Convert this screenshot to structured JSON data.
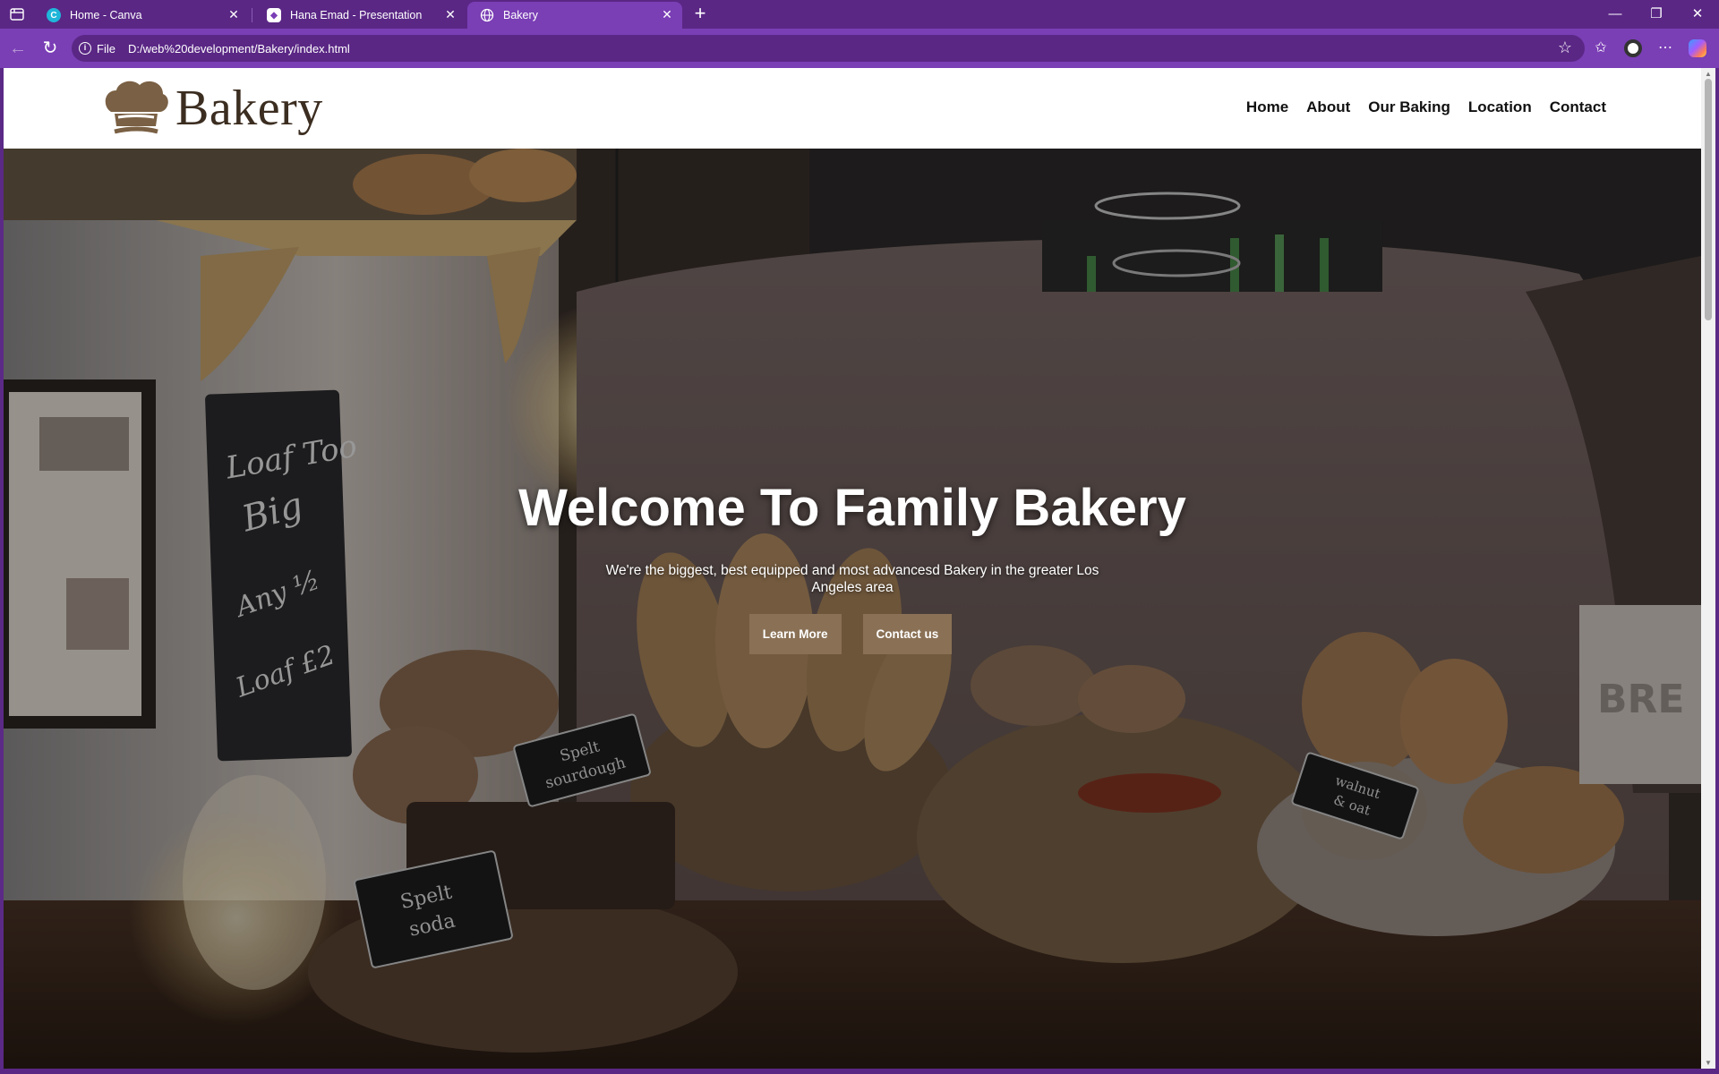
{
  "browser": {
    "tabs": [
      {
        "title": "Home - Canva",
        "active": false,
        "favicon": "canva-icon"
      },
      {
        "title": "Hana Emad - Presentation",
        "active": false,
        "favicon": "canva-presentation-icon"
      },
      {
        "title": "Bakery",
        "active": true,
        "favicon": "globe-icon"
      }
    ],
    "address": {
      "scheme_label": "File",
      "url": "D:/web%20development/Bakery/index.html"
    },
    "colors": {
      "chrome": "#5a2785",
      "active": "#7a3eb5"
    }
  },
  "site": {
    "logo_text": "Bakery",
    "nav": [
      "Home",
      "About",
      "Our Baking",
      "Location",
      "Contact"
    ],
    "hero": {
      "title": "Welcome To Family Bakery",
      "subtitle": "We're the biggest, best equipped and most advancesd Bakery in the greater Los Angeles area",
      "buttons": [
        "Learn More",
        "Contact us"
      ]
    },
    "chalkboard_text": "Loaf Too Big - Any 1/2 Loaf £2",
    "labels": [
      "Spelt sourdough",
      "Spelt soda",
      "Walnut & oat",
      "BREAD"
    ],
    "colors": {
      "button": "#8a7155",
      "logo": "#7a6044"
    }
  }
}
